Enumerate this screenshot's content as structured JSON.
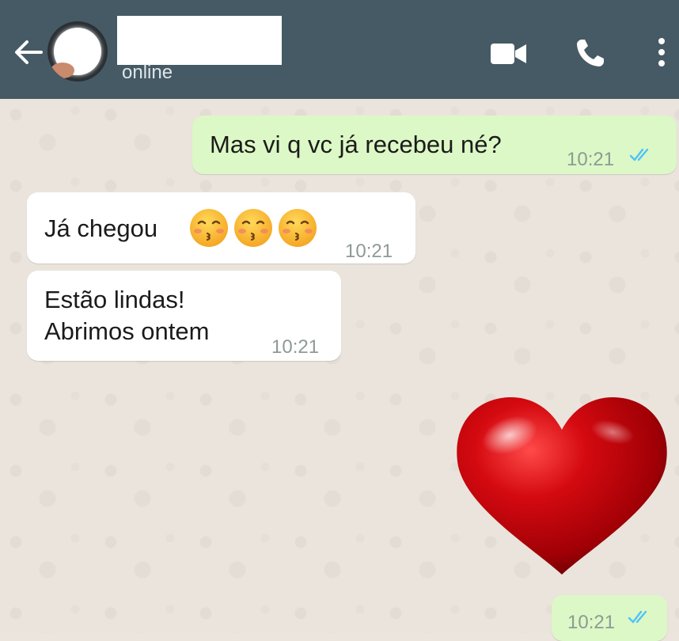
{
  "header": {
    "status": "online",
    "background_color": "#455a64",
    "icons": [
      "back-arrow-icon",
      "video-call-icon",
      "phone-call-icon",
      "more-menu-icon"
    ]
  },
  "messages": [
    {
      "direction": "outgoing",
      "text": "Mas vi q vc já recebeu né?",
      "time": "10:21",
      "ticks": "read"
    },
    {
      "direction": "incoming",
      "text": "Já chegou",
      "emojis": [
        "kissing-face-emoji",
        "kissing-face-emoji",
        "kissing-face-emoji"
      ],
      "time": "10:21"
    },
    {
      "direction": "incoming",
      "lines": [
        "Estão lindas!",
        "Abrimos ontem"
      ],
      "time": "10:21"
    },
    {
      "direction": "outgoing",
      "sticker": "red-heart-sticker",
      "time": "10:21",
      "ticks": "read"
    }
  ],
  "colors": {
    "outgoing_bubble": "#dcf8c6",
    "incoming_bubble": "#ffffff",
    "read_ticks": "#4fc3f7",
    "heart": "#c8050b"
  }
}
